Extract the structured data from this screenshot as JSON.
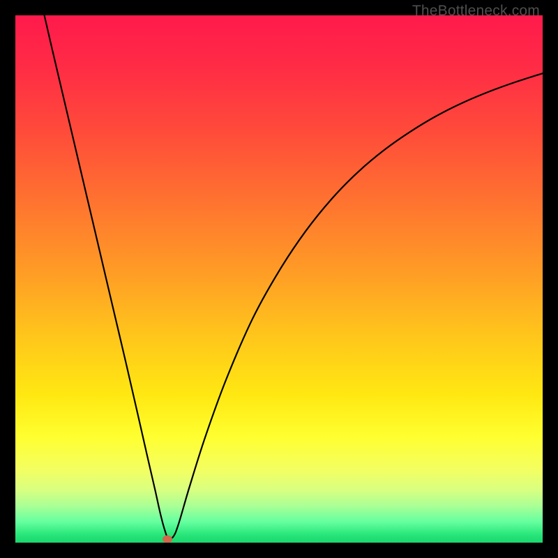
{
  "watermark": "TheBottleneck.com",
  "chart_data": {
    "type": "line",
    "title": "",
    "xlabel": "",
    "ylabel": "",
    "xlim": [
      0,
      100
    ],
    "ylim": [
      0,
      100
    ],
    "grid": false,
    "legend": false,
    "gradient_stops": [
      {
        "pos": 0.0,
        "color": "#ff1a4c"
      },
      {
        "pos": 0.1,
        "color": "#ff2c45"
      },
      {
        "pos": 0.22,
        "color": "#ff4b3a"
      },
      {
        "pos": 0.35,
        "color": "#ff7230"
      },
      {
        "pos": 0.48,
        "color": "#ff9a26"
      },
      {
        "pos": 0.6,
        "color": "#ffc31c"
      },
      {
        "pos": 0.72,
        "color": "#ffe812"
      },
      {
        "pos": 0.8,
        "color": "#ffff30"
      },
      {
        "pos": 0.86,
        "color": "#f4ff60"
      },
      {
        "pos": 0.9,
        "color": "#d9ff80"
      },
      {
        "pos": 0.93,
        "color": "#aaff95"
      },
      {
        "pos": 0.96,
        "color": "#66ffa0"
      },
      {
        "pos": 0.985,
        "color": "#28e679"
      },
      {
        "pos": 1.0,
        "color": "#1ad66f"
      }
    ],
    "series": [
      {
        "name": "bottleneck-curve",
        "x": [
          5.5,
          7,
          9,
          11,
          13,
          15,
          17,
          19,
          21,
          23,
          25,
          26.5,
          27.5,
          28.3,
          29,
          30,
          31,
          33,
          36,
          40,
          45,
          50,
          55,
          60,
          65,
          70,
          75,
          80,
          85,
          90,
          95,
          100
        ],
        "y": [
          100,
          93.5,
          85,
          76.5,
          68,
          59.5,
          51,
          42.5,
          34,
          25.3,
          16.5,
          10,
          5.5,
          2.5,
          0.8,
          1.2,
          3.7,
          10.5,
          20,
          31,
          42.5,
          51.5,
          59,
          65.2,
          70.3,
          74.5,
          78,
          81,
          83.5,
          85.6,
          87.4,
          89
        ]
      }
    ],
    "marker": {
      "x": 28.8,
      "y": 0.6,
      "color": "#d1674b"
    }
  }
}
